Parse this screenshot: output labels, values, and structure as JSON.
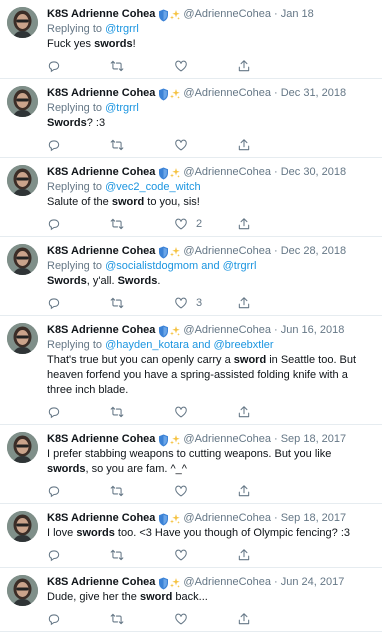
{
  "tweets": [
    {
      "name": "K8S Adrienne Cohea",
      "handle": "@AdrienneCohea",
      "date": "Jan 18",
      "replying_prefix": "Replying to ",
      "replying_to": "@trgrrl",
      "text": [
        "Fuck yes ",
        "swords",
        "!"
      ],
      "retweets": "",
      "likes": ""
    },
    {
      "name": "K8S Adrienne Cohea",
      "handle": "@AdrienneCohea",
      "date": "Dec 31, 2018",
      "replying_prefix": "Replying to ",
      "replying_to": "@trgrrl",
      "text": [
        "",
        "Swords",
        "? :3"
      ],
      "retweets": "",
      "likes": ""
    },
    {
      "name": "K8S Adrienne Cohea",
      "handle": "@AdrienneCohea",
      "date": "Dec 30, 2018",
      "replying_prefix": "Replying to ",
      "replying_to": "@vec2_code_witch",
      "text": [
        "Salute of the ",
        "sword",
        " to you, sis!"
      ],
      "retweets": "",
      "likes": "2"
    },
    {
      "name": "K8S Adrienne Cohea",
      "handle": "@AdrienneCohea",
      "date": "Dec 28, 2018",
      "replying_prefix": "Replying to ",
      "replying_to": "@socialistdogmom and @trgrrl",
      "text": [
        "",
        "Swords",
        ", y'all. ",
        "Swords",
        "."
      ],
      "retweets": "",
      "likes": "3"
    },
    {
      "name": "K8S Adrienne Cohea",
      "handle": "@AdrienneCohea",
      "date": "Jun 16, 2018",
      "replying_prefix": "Replying to ",
      "replying_to": "@hayden_kotara and @breebxtler",
      "text": [
        "That's true but you can openly carry a ",
        "sword",
        " in Seattle too. But heaven forfend you have a spring-assisted folding knife with a three inch blade."
      ],
      "retweets": "",
      "likes": ""
    },
    {
      "name": "K8S Adrienne Cohea",
      "handle": "@AdrienneCohea",
      "date": "Sep 18, 2017",
      "replying_prefix": "",
      "replying_to": "",
      "text": [
        "I prefer stabbing weapons to cutting weapons. But you like ",
        "swords",
        ", so you are fam. ^_^"
      ],
      "retweets": "",
      "likes": ""
    },
    {
      "name": "K8S Adrienne Cohea",
      "handle": "@AdrienneCohea",
      "date": "Sep 18, 2017",
      "replying_prefix": "",
      "replying_to": "",
      "text": [
        "I love ",
        "swords",
        " too. <3 Have you though of Olympic fencing? :3"
      ],
      "retweets": "",
      "likes": ""
    },
    {
      "name": "K8S Adrienne Cohea",
      "handle": "@AdrienneCohea",
      "date": "Jun 24, 2017",
      "replying_prefix": "",
      "replying_to": "",
      "text": [
        "Dude, give her the ",
        "sword",
        " back..."
      ],
      "retweets": "",
      "likes": ""
    }
  ],
  "separator": "·",
  "icons": {
    "badge_shield": "blue-shield-icon",
    "badge_sparkle": "sparkles-icon",
    "reply": "reply-icon",
    "retweet": "retweet-icon",
    "like": "heart-icon",
    "share": "share-icon"
  },
  "colors": {
    "link": "#1b95e0",
    "secondary_text": "#657786",
    "divider": "#e6ecf0",
    "shield": "#3b82d6",
    "sparkle": "#f5c342"
  }
}
